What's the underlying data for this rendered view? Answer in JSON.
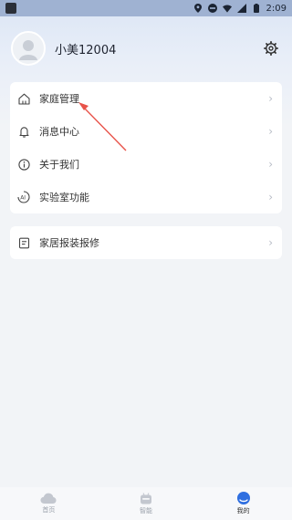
{
  "status_bar": {
    "time": "2:09"
  },
  "profile": {
    "username": "小美12004"
  },
  "menu": {
    "items": [
      {
        "label": "家庭管理",
        "icon": "home-icon"
      },
      {
        "label": "消息中心",
        "icon": "bell-icon"
      },
      {
        "label": "关于我们",
        "icon": "info-icon"
      },
      {
        "label": "实验室功能",
        "icon": "ai-lab-icon"
      }
    ],
    "extra": {
      "label": "家居报装报修",
      "icon": "document-icon"
    }
  },
  "tabbar": {
    "tabs": [
      {
        "label": "首页",
        "icon": "cloud-icon"
      },
      {
        "label": "智能",
        "icon": "robot-icon"
      },
      {
        "label": "我的",
        "icon": "user-icon"
      }
    ],
    "active_tab": "我的"
  },
  "colors": {
    "accent": "#2f6fe0",
    "annotation_arrow": "#e8534a"
  }
}
